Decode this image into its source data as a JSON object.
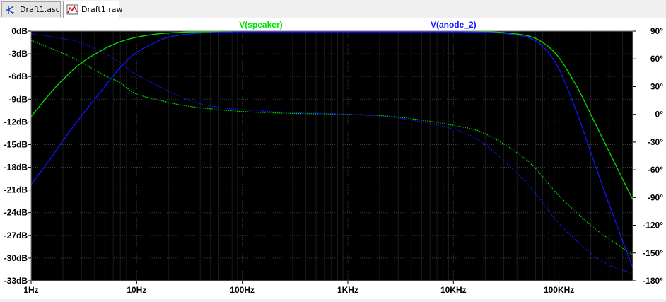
{
  "tabs": [
    {
      "label": "Draft1.asc",
      "icon": "schematic-icon"
    },
    {
      "label": "Draft1.raw",
      "icon": "waveform-icon"
    }
  ],
  "colors": {
    "plot_bg": "#000000",
    "axis_frame": "#808080",
    "grid": "#3a3a3a",
    "series_speaker": "#00e000",
    "series_anode": "#1414ff"
  },
  "chart_data": {
    "type": "line",
    "x_scale": "log",
    "xlim": [
      1,
      500000
    ],
    "ylim": [
      -33,
      0
    ],
    "y2lim": [
      -180,
      90
    ],
    "grid": true,
    "x_ticks": [
      {
        "value": 1,
        "label": "1Hz"
      },
      {
        "value": 10,
        "label": "10Hz"
      },
      {
        "value": 100,
        "label": "100Hz"
      },
      {
        "value": 1000,
        "label": "1KHz"
      },
      {
        "value": 10000,
        "label": "10KHz"
      },
      {
        "value": 100000,
        "label": "100KHz"
      }
    ],
    "y_ticks": [
      {
        "value": 0,
        "label": "0dB"
      },
      {
        "value": -3,
        "label": "-3dB"
      },
      {
        "value": -6,
        "label": "-6dB"
      },
      {
        "value": -9,
        "label": "-9dB"
      },
      {
        "value": -12,
        "label": "-12dB"
      },
      {
        "value": -15,
        "label": "-15dB"
      },
      {
        "value": -18,
        "label": "-18dB"
      },
      {
        "value": -21,
        "label": "-21dB"
      },
      {
        "value": -24,
        "label": "-24dB"
      },
      {
        "value": -27,
        "label": "-27dB"
      },
      {
        "value": -30,
        "label": "-30dB"
      },
      {
        "value": -33,
        "label": "-33dB"
      }
    ],
    "y2_ticks": [
      {
        "value": 90,
        "label": "90°"
      },
      {
        "value": 60,
        "label": "60°"
      },
      {
        "value": 30,
        "label": "30°"
      },
      {
        "value": 0,
        "label": "0°"
      },
      {
        "value": -30,
        "label": "-30°"
      },
      {
        "value": -60,
        "label": "-60°"
      },
      {
        "value": -90,
        "label": "-90°"
      },
      {
        "value": -120,
        "label": "-120°"
      },
      {
        "value": -150,
        "label": "-150°"
      },
      {
        "value": -180,
        "label": "-180°"
      }
    ],
    "series": [
      {
        "name": "V(speaker)",
        "color": "#00e000",
        "magnitude_db": [
          {
            "x": 1,
            "y": -11.3
          },
          {
            "x": 1.5,
            "y": -8.3
          },
          {
            "x": 2,
            "y": -6.4
          },
          {
            "x": 3,
            "y": -4.2
          },
          {
            "x": 5,
            "y": -2.3
          },
          {
            "x": 7,
            "y": -1.4
          },
          {
            "x": 10,
            "y": -0.8
          },
          {
            "x": 15,
            "y": -0.4
          },
          {
            "x": 20,
            "y": -0.25
          },
          {
            "x": 30,
            "y": -0.12
          },
          {
            "x": 50,
            "y": -0.08
          },
          {
            "x": 100,
            "y": -0.05
          },
          {
            "x": 1000,
            "y": -0.05
          },
          {
            "x": 10000,
            "y": -0.05
          },
          {
            "x": 20000,
            "y": -0.1
          },
          {
            "x": 30000,
            "y": -0.2
          },
          {
            "x": 50000,
            "y": -0.6
          },
          {
            "x": 70000,
            "y": -1.5
          },
          {
            "x": 100000,
            "y": -3.5
          },
          {
            "x": 150000,
            "y": -7.5
          },
          {
            "x": 200000,
            "y": -11
          },
          {
            "x": 300000,
            "y": -16
          },
          {
            "x": 500000,
            "y": -22.3
          }
        ],
        "phase_deg": [
          {
            "x": 1,
            "y": 80
          },
          {
            "x": 2,
            "y": 66
          },
          {
            "x": 3,
            "y": 56
          },
          {
            "x": 5,
            "y": 42
          },
          {
            "x": 7,
            "y": 34
          },
          {
            "x": 10,
            "y": 22
          },
          {
            "x": 20,
            "y": 13
          },
          {
            "x": 30,
            "y": 9
          },
          {
            "x": 50,
            "y": 6
          },
          {
            "x": 100,
            "y": 3
          },
          {
            "x": 300,
            "y": 1
          },
          {
            "x": 1000,
            "y": 0
          },
          {
            "x": 3000,
            "y": -3
          },
          {
            "x": 10000,
            "y": -12
          },
          {
            "x": 20000,
            "y": -21
          },
          {
            "x": 50000,
            "y": -50
          },
          {
            "x": 100000,
            "y": -88
          },
          {
            "x": 200000,
            "y": -120
          },
          {
            "x": 300000,
            "y": -135
          },
          {
            "x": 500000,
            "y": -152
          }
        ]
      },
      {
        "name": "V(anode_2)",
        "color": "#1414ff",
        "magnitude_db": [
          {
            "x": 1,
            "y": -20.3
          },
          {
            "x": 1.5,
            "y": -17
          },
          {
            "x": 2,
            "y": -14.5
          },
          {
            "x": 3,
            "y": -11.2
          },
          {
            "x": 5,
            "y": -7.3
          },
          {
            "x": 7,
            "y": -4.8
          },
          {
            "x": 10,
            "y": -2.8
          },
          {
            "x": 15,
            "y": -1.5
          },
          {
            "x": 20,
            "y": -0.8
          },
          {
            "x": 30,
            "y": -0.4
          },
          {
            "x": 50,
            "y": -0.2
          },
          {
            "x": 100,
            "y": -0.1
          },
          {
            "x": 1000,
            "y": -0.1
          },
          {
            "x": 10000,
            "y": -0.1
          },
          {
            "x": 20000,
            "y": -0.15
          },
          {
            "x": 30000,
            "y": -0.3
          },
          {
            "x": 50000,
            "y": -0.8
          },
          {
            "x": 70000,
            "y": -2
          },
          {
            "x": 100000,
            "y": -5
          },
          {
            "x": 150000,
            "y": -11
          },
          {
            "x": 200000,
            "y": -16
          },
          {
            "x": 300000,
            "y": -23
          },
          {
            "x": 500000,
            "y": -31.3
          }
        ],
        "phase_deg": [
          {
            "x": 1,
            "y": 87
          },
          {
            "x": 2,
            "y": 82
          },
          {
            "x": 3,
            "y": 77
          },
          {
            "x": 5,
            "y": 66
          },
          {
            "x": 7,
            "y": 55
          },
          {
            "x": 10,
            "y": 43
          },
          {
            "x": 20,
            "y": 25
          },
          {
            "x": 30,
            "y": 16
          },
          {
            "x": 50,
            "y": 9
          },
          {
            "x": 100,
            "y": 5
          },
          {
            "x": 300,
            "y": 2
          },
          {
            "x": 1000,
            "y": 0
          },
          {
            "x": 3000,
            "y": -4
          },
          {
            "x": 10000,
            "y": -16
          },
          {
            "x": 20000,
            "y": -33
          },
          {
            "x": 50000,
            "y": -75
          },
          {
            "x": 100000,
            "y": -118
          },
          {
            "x": 200000,
            "y": -150
          },
          {
            "x": 300000,
            "y": -163
          },
          {
            "x": 500000,
            "y": -172
          }
        ]
      }
    ]
  }
}
